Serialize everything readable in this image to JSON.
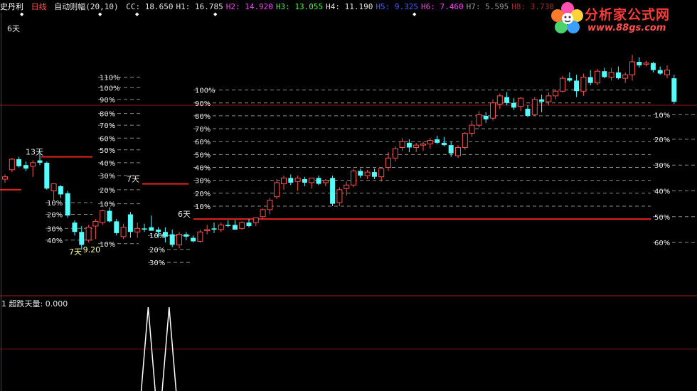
{
  "header": {
    "stock_name": "史丹利",
    "period": "日线",
    "indicator_name": "自动则幅(20,10)",
    "values": [
      {
        "label": "CC:",
        "value": "18.650",
        "color": "#e6e6e6"
      },
      {
        "label": "H1:",
        "value": "16.785",
        "color": "#e6e6e6"
      },
      {
        "label": "H2:",
        "value": "14.920",
        "color": "#ff40ff"
      },
      {
        "label": "H3:",
        "value": "13.055",
        "color": "#40ff40"
      },
      {
        "label": "H4:",
        "value": "11.190",
        "color": "#e6e6e6"
      },
      {
        "label": "H5:",
        "value": "9.325",
        "color": "#4a5cff"
      },
      {
        "label": "H6:",
        "value": "7.460",
        "color": "#ff40ff"
      },
      {
        "label": "H7:",
        "value": "5.595",
        "color": "#9a9a9a"
      },
      {
        "label": "H8:",
        "value": "3.730",
        "color": "#a03030"
      }
    ]
  },
  "logo": {
    "brand": "分析家公式网",
    "url": "www.88gs.com"
  },
  "days_label": "6天",
  "sub_panel": {
    "index": "1",
    "title": "超跌天量:",
    "value": "0.000"
  },
  "chart_data": [
    {
      "type": "candlestick",
      "title": "",
      "colors": {
        "up": "#ff5050",
        "down": "#54fcfc",
        "background": "#000000"
      },
      "ylim": [
        0,
        10.5
      ],
      "candles": [
        {
          "o": 6.0,
          "h": 6.2,
          "l": 5.85,
          "c": 6.1
        },
        {
          "o": 6.4,
          "h": 6.9,
          "l": 6.3,
          "c": 6.85
        },
        {
          "o": 6.85,
          "h": 6.95,
          "l": 6.5,
          "c": 6.55
        },
        {
          "o": 6.6,
          "h": 6.75,
          "l": 6.35,
          "c": 6.45
        },
        {
          "o": 6.55,
          "h": 6.8,
          "l": 6.1,
          "c": 6.7
        },
        {
          "o": 6.8,
          "h": 7.2,
          "l": 6.6,
          "c": 6.7
        },
        {
          "o": 6.7,
          "h": 6.75,
          "l": 5.55,
          "c": 5.6
        },
        {
          "o": 5.5,
          "h": 5.75,
          "l": 5.1,
          "c": 5.8
        },
        {
          "o": 5.7,
          "h": 5.75,
          "l": 5.2,
          "c": 5.35
        },
        {
          "o": 5.4,
          "h": 5.5,
          "l": 4.35,
          "c": 4.45
        },
        {
          "o": 4.15,
          "h": 4.25,
          "l": 3.6,
          "c": 3.75
        },
        {
          "o": 3.75,
          "h": 4.0,
          "l": 3.0,
          "c": 3.2
        },
        {
          "o": 3.4,
          "h": 4.05,
          "l": 3.3,
          "c": 3.95
        },
        {
          "o": 4.0,
          "h": 4.3,
          "l": 3.45,
          "c": 4.2
        },
        {
          "o": 4.15,
          "h": 4.7,
          "l": 4.05,
          "c": 4.65
        },
        {
          "o": 4.65,
          "h": 4.8,
          "l": 4.15,
          "c": 4.2
        },
        {
          "o": 4.2,
          "h": 4.3,
          "l": 3.6,
          "c": 3.7
        },
        {
          "o": 3.55,
          "h": 4.1,
          "l": 3.45,
          "c": 3.95
        },
        {
          "o": 4.5,
          "h": 4.6,
          "l": 3.5,
          "c": 3.75
        },
        {
          "o": 3.75,
          "h": 4.15,
          "l": 3.5,
          "c": 3.9
        },
        {
          "o": 3.9,
          "h": 4.1,
          "l": 3.75,
          "c": 3.85
        },
        {
          "o": 3.95,
          "h": 4.45,
          "l": 3.8,
          "c": 3.8
        },
        {
          "o": 3.85,
          "h": 3.95,
          "l": 3.5,
          "c": 3.75
        },
        {
          "o": 3.75,
          "h": 3.95,
          "l": 3.3,
          "c": 3.55
        },
        {
          "o": 3.65,
          "h": 3.85,
          "l": 3.1,
          "c": 3.2
        },
        {
          "o": 3.2,
          "h": 3.75,
          "l": 3.05,
          "c": 3.65
        },
        {
          "o": 3.65,
          "h": 3.75,
          "l": 3.4,
          "c": 3.55
        },
        {
          "o": 3.5,
          "h": 3.6,
          "l": 3.3,
          "c": 3.35
        },
        {
          "o": 3.35,
          "h": 3.85,
          "l": 3.3,
          "c": 3.75
        },
        {
          "o": 3.8,
          "h": 4.05,
          "l": 3.65,
          "c": 3.85
        },
        {
          "o": 3.9,
          "h": 4.15,
          "l": 3.7,
          "c": 3.85
        },
        {
          "o": 3.85,
          "h": 4.15,
          "l": 3.75,
          "c": 4.05
        },
        {
          "o": 4.05,
          "h": 4.25,
          "l": 3.95,
          "c": 4.0
        },
        {
          "o": 4.05,
          "h": 4.25,
          "l": 3.85,
          "c": 3.85
        },
        {
          "o": 3.9,
          "h": 4.2,
          "l": 3.85,
          "c": 4.15
        },
        {
          "o": 4.15,
          "h": 4.3,
          "l": 3.95,
          "c": 4.0
        },
        {
          "o": 4.15,
          "h": 4.35,
          "l": 4.0,
          "c": 4.35
        },
        {
          "o": 4.4,
          "h": 4.75,
          "l": 4.3,
          "c": 4.7
        },
        {
          "o": 4.7,
          "h": 5.2,
          "l": 4.5,
          "c": 5.1
        },
        {
          "o": 5.25,
          "h": 6.0,
          "l": 5.15,
          "c": 5.85
        },
        {
          "o": 5.8,
          "h": 6.15,
          "l": 5.55,
          "c": 6.05
        },
        {
          "o": 6.05,
          "h": 6.2,
          "l": 5.75,
          "c": 5.85
        },
        {
          "o": 5.9,
          "h": 6.15,
          "l": 5.5,
          "c": 6.05
        },
        {
          "o": 6.0,
          "h": 6.1,
          "l": 5.7,
          "c": 5.85
        },
        {
          "o": 5.85,
          "h": 6.05,
          "l": 5.6,
          "c": 6.05
        },
        {
          "o": 6.05,
          "h": 6.15,
          "l": 5.75,
          "c": 5.8
        },
        {
          "o": 5.85,
          "h": 6.0,
          "l": 5.7,
          "c": 5.95
        },
        {
          "o": 6.05,
          "h": 6.15,
          "l": 4.85,
          "c": 4.95
        },
        {
          "o": 5.0,
          "h": 5.65,
          "l": 4.85,
          "c": 5.55
        },
        {
          "o": 5.6,
          "h": 5.9,
          "l": 5.3,
          "c": 5.75
        },
        {
          "o": 5.75,
          "h": 6.45,
          "l": 5.65,
          "c": 6.35
        },
        {
          "o": 6.35,
          "h": 6.45,
          "l": 6.05,
          "c": 6.15
        },
        {
          "o": 6.15,
          "h": 6.4,
          "l": 6.0,
          "c": 6.3
        },
        {
          "o": 6.3,
          "h": 6.45,
          "l": 6.0,
          "c": 6.1
        },
        {
          "o": 6.1,
          "h": 6.45,
          "l": 5.9,
          "c": 6.45
        },
        {
          "o": 6.5,
          "h": 7.15,
          "l": 6.35,
          "c": 6.9
        },
        {
          "o": 6.9,
          "h": 7.4,
          "l": 6.75,
          "c": 7.3
        },
        {
          "o": 7.35,
          "h": 7.75,
          "l": 7.2,
          "c": 7.6
        },
        {
          "o": 7.55,
          "h": 7.7,
          "l": 7.15,
          "c": 7.35
        },
        {
          "o": 7.35,
          "h": 7.55,
          "l": 7.15,
          "c": 7.45
        },
        {
          "o": 7.45,
          "h": 7.6,
          "l": 7.2,
          "c": 7.5
        },
        {
          "o": 7.5,
          "h": 7.75,
          "l": 7.3,
          "c": 7.65
        },
        {
          "o": 7.7,
          "h": 7.85,
          "l": 7.5,
          "c": 7.55
        },
        {
          "o": 7.55,
          "h": 7.8,
          "l": 7.4,
          "c": 7.45
        },
        {
          "o": 7.45,
          "h": 7.6,
          "l": 6.95,
          "c": 7.1
        },
        {
          "o": 7.0,
          "h": 7.45,
          "l": 6.9,
          "c": 7.35
        },
        {
          "o": 7.35,
          "h": 8.0,
          "l": 7.25,
          "c": 7.95
        },
        {
          "o": 7.95,
          "h": 8.5,
          "l": 7.8,
          "c": 8.3
        },
        {
          "o": 8.3,
          "h": 8.9,
          "l": 8.2,
          "c": 8.75
        },
        {
          "o": 8.7,
          "h": 8.85,
          "l": 8.4,
          "c": 8.55
        },
        {
          "o": 8.6,
          "h": 9.4,
          "l": 8.5,
          "c": 9.25
        },
        {
          "o": 9.2,
          "h": 9.65,
          "l": 9.0,
          "c": 9.55
        },
        {
          "o": 9.5,
          "h": 9.7,
          "l": 9.15,
          "c": 9.25
        },
        {
          "o": 9.25,
          "h": 9.45,
          "l": 8.95,
          "c": 9.05
        },
        {
          "o": 9.1,
          "h": 9.5,
          "l": 8.9,
          "c": 9.45
        },
        {
          "o": 9.0,
          "h": 9.15,
          "l": 8.65,
          "c": 8.7
        },
        {
          "o": 8.75,
          "h": 9.5,
          "l": 8.7,
          "c": 9.4
        },
        {
          "o": 9.4,
          "h": 9.6,
          "l": 8.85,
          "c": 9.3
        },
        {
          "o": 9.3,
          "h": 9.7,
          "l": 9.15,
          "c": 9.55
        },
        {
          "o": 9.55,
          "h": 9.8,
          "l": 9.4,
          "c": 9.75
        },
        {
          "o": 9.75,
          "h": 10.4,
          "l": 9.7,
          "c": 10.3
        },
        {
          "o": 10.3,
          "h": 10.55,
          "l": 10.15,
          "c": 10.2
        },
        {
          "o": 10.2,
          "h": 10.45,
          "l": 9.5,
          "c": 9.75
        },
        {
          "o": 9.75,
          "h": 10.5,
          "l": 9.55,
          "c": 10.35
        },
        {
          "o": 10.35,
          "h": 10.65,
          "l": 10.0,
          "c": 10.1
        },
        {
          "o": 10.1,
          "h": 10.7,
          "l": 10.0,
          "c": 10.6
        },
        {
          "o": 10.6,
          "h": 10.75,
          "l": 10.3,
          "c": 10.35
        },
        {
          "o": 10.35,
          "h": 10.75,
          "l": 10.2,
          "c": 10.55
        },
        {
          "o": 10.55,
          "h": 10.8,
          "l": 10.25,
          "c": 10.3
        },
        {
          "o": 10.3,
          "h": 10.55,
          "l": 10.1,
          "c": 10.45
        },
        {
          "o": 10.45,
          "h": 11.3,
          "l": 10.2,
          "c": 11.0
        },
        {
          "o": 11.0,
          "h": 11.2,
          "l": 10.75,
          "c": 10.85
        },
        {
          "o": 10.9,
          "h": 11.05,
          "l": 10.8,
          "c": 10.95
        },
        {
          "o": 10.95,
          "h": 11.0,
          "l": 10.55,
          "c": 10.65
        },
        {
          "o": 10.65,
          "h": 10.8,
          "l": 10.45,
          "c": 10.5
        },
        {
          "o": 10.45,
          "h": 10.85,
          "l": 10.3,
          "c": 10.65
        },
        {
          "o": 10.3,
          "h": 10.45,
          "l": 9.2,
          "c": 9.3
        }
      ],
      "ruler_sets": [
        {
          "x_from": 138,
          "x_to": 200,
          "levels": [
            {
              "label": "110%",
              "value": 10.35
            },
            {
              "label": "100%",
              "value": 9.9
            },
            {
              "label": "90%",
              "value": 9.4
            },
            {
              "label": "80%",
              "value": 8.8
            },
            {
              "label": "70%",
              "value": 8.3
            },
            {
              "label": "60%",
              "value": 7.75
            },
            {
              "label": "50%",
              "value": 7.25
            },
            {
              "label": "40%",
              "value": 6.7
            },
            {
              "label": "30%",
              "value": 6.15
            },
            {
              "label": "20%",
              "value": 5.55
            },
            {
              "label": "10%",
              "value": 4.95
            }
          ]
        },
        {
          "x_from": 64,
          "x_to": 130,
          "levels": [
            {
              "label": "10%",
              "value": 5.0
            },
            {
              "label": "20%",
              "value": 4.5
            },
            {
              "label": "30%",
              "value": 3.9
            },
            {
              "label": "40%",
              "value": 3.4
            }
          ]
        },
        {
          "x_from": 138,
          "x_to": 195,
          "levels": [
            {
              "label": "10%",
              "value": 3.25
            }
          ]
        },
        {
          "x_from": 208,
          "x_to": 268,
          "levels": [
            {
              "label": "10%",
              "value": 3.6
            },
            {
              "label": "20%",
              "value": 3.0
            },
            {
              "label": "30%",
              "value": 2.45
            }
          ]
        },
        {
          "x_from": 272,
          "x_to": 915,
          "levels": [
            {
              "label": "100%",
              "value": 9.8
            },
            {
              "label": "90%",
              "value": 9.25
            },
            {
              "label": "80%",
              "value": 8.7
            },
            {
              "label": "70%",
              "value": 8.15
            },
            {
              "label": "60%",
              "value": 7.6
            },
            {
              "label": "50%",
              "value": 7.05
            },
            {
              "label": "40%",
              "value": 6.5
            },
            {
              "label": "30%",
              "value": 5.95
            },
            {
              "label": "20%",
              "value": 5.4
            },
            {
              "label": "10%",
              "value": 4.85
            }
          ]
        },
        {
          "x_from": 918,
          "x_to": 980,
          "levels": [
            {
              "label": "10%",
              "value": 8.75
            },
            {
              "label": "20%",
              "value": 7.7
            },
            {
              "label": "30%",
              "value": 6.6
            },
            {
              "label": "40%",
              "value": 5.5
            },
            {
              "label": "50%",
              "value": 4.4
            },
            {
              "label": "60%",
              "value": 3.3
            }
          ]
        }
      ],
      "red_lines": [
        {
          "x_from": 58,
          "x_to": 130,
          "value": 6.95,
          "label": "13天"
        },
        {
          "x_from": 0,
          "x_to": 30,
          "value": 5.55,
          "label": ""
        },
        {
          "x_from": 200,
          "x_to": 265,
          "value": 5.8,
          "label": "7天"
        },
        {
          "x_from": 272,
          "x_to": 915,
          "value": 4.3,
          "label": "6天"
        }
      ],
      "annotations": [
        {
          "text": "7天",
          "candle": 10,
          "value": 3.15
        },
        {
          "text": "9.20",
          "candle": 12,
          "value": 3.25
        }
      ]
    },
    {
      "type": "line",
      "title": "超跌天量",
      "values_by_candle": [
        {
          "candle": 23,
          "value": 1
        },
        {
          "candle": 26,
          "value": 1
        }
      ],
      "ylim": [
        0,
        1
      ]
    }
  ]
}
